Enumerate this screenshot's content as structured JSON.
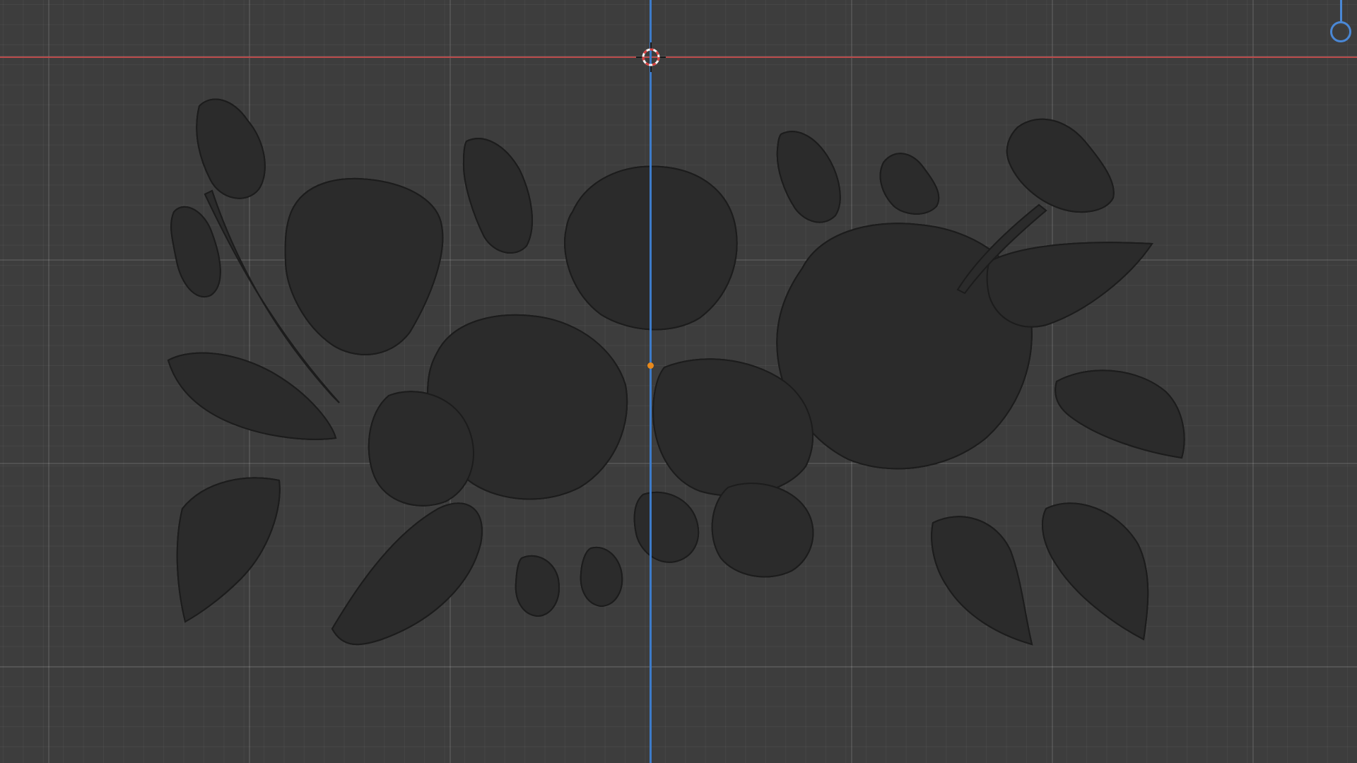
{
  "app": "3D viewport",
  "view": "wireframe",
  "colors": {
    "background": "#3d3d3d",
    "x_axis": "#b94a4a",
    "y_axis": "#3d7bc9",
    "mesh_wire": "#1c1c1c",
    "mesh_fill": "#2b2b2b",
    "origin": "#e8891c",
    "cursor_red": "#d94040",
    "cursor_white": "#f2f2f2",
    "gizmo": "#4a88d6"
  },
  "icons": {
    "cursor": "3d-cursor-icon",
    "origin": "object-origin-icon",
    "gizmo": "navigation-gizmo-z-axis-icon"
  },
  "scene": {
    "object": "floral-wireframe-mesh",
    "axes": [
      "x-axis",
      "y-axis"
    ]
  }
}
